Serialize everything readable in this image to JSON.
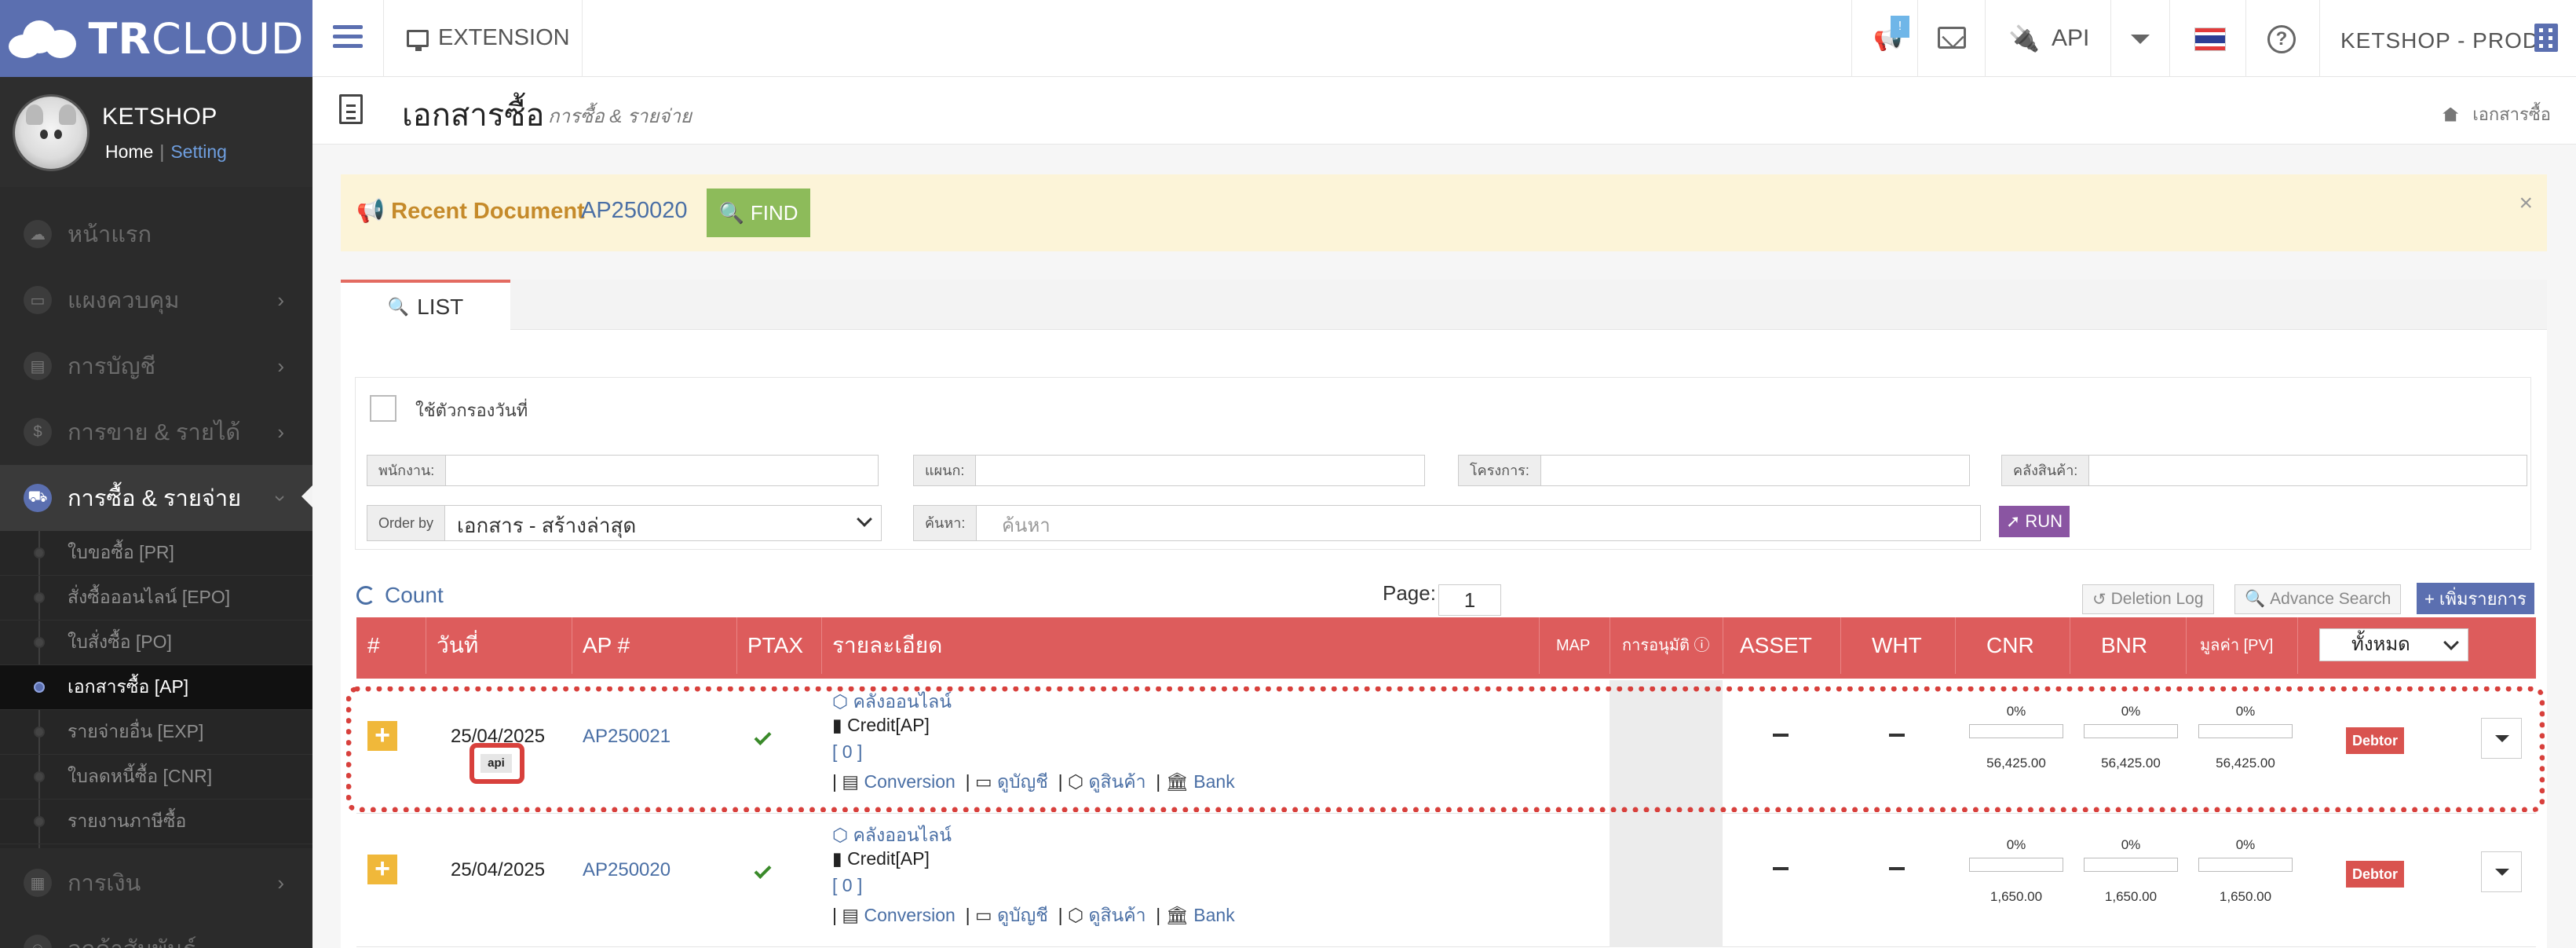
{
  "logo": {
    "bold": "TR",
    "light": "CLOUD"
  },
  "profile": {
    "name": "KETSHOP",
    "home": "Home",
    "sep": "|",
    "setting": "Setting"
  },
  "sidebar": {
    "items": [
      {
        "label": "หน้าแรก",
        "icon": "cloud-icon"
      },
      {
        "label": "แผงควบคุม",
        "icon": "monitor-icon"
      },
      {
        "label": "การบัญชี",
        "icon": "book-icon"
      },
      {
        "label": "การขาย & รายได้",
        "icon": "dollar-icon"
      },
      {
        "label": "การซื้อ & รายจ่าย",
        "icon": "cart-icon"
      },
      {
        "label": "การเงิน",
        "icon": "calendar-icon"
      },
      {
        "label": "ลูกค้าสัมพันธ์",
        "icon": "users-icon"
      }
    ],
    "sub_items": [
      "ใบขอซื้อ [PR]",
      "สั่งซื้อออนไลน์ [EPO]",
      "ใบสั่งซื้อ [PO]",
      "เอกสารซื้อ [AP]",
      "รายจ่ายอื่น [EXP]",
      "ใบลดหนี้ซื้อ [CNR]",
      "รายงานภาษีซื้อ"
    ]
  },
  "header": {
    "extension": "EXTENSION",
    "badge": "!",
    "api": "API",
    "account": "KETSHOP - PROD"
  },
  "page": {
    "title": "เอกสารซื้อ",
    "subtitle": "การซื้อ & รายจ่าย",
    "breadcrumb": "เอกสารซื้อ"
  },
  "recent": {
    "label": "Recent Document",
    "doc": "AP250020",
    "find": "FIND",
    "close": "×"
  },
  "tabs": {
    "list": "LIST"
  },
  "filter": {
    "date_filter": "ใช้ตัวกรองวันที่",
    "employee": "พนักงาน:",
    "department": "แผนก:",
    "project": "โครงการ:",
    "warehouse": "คลังสินค้า:",
    "order_by": "Order by",
    "order_value": "เอกสาร - สร้างล่าสุด",
    "search_label": "ค้นหา:",
    "search_placeholder": "ค้นหา",
    "run": "RUN"
  },
  "list": {
    "count": "Count",
    "page_label": "Page:",
    "page": "1",
    "deletion_log": "Deletion Log",
    "advanced_search": "Advance Search",
    "add": "+ เพิ่มรายการ"
  },
  "table": {
    "headers": {
      "no": "#",
      "date": "วันที่",
      "ap": "AP #",
      "ptax": "PTAX",
      "detail": "รายละเอียด",
      "map": "MAP",
      "approve": "การอนุมัติ",
      "asset": "ASSET",
      "wht": "WHT",
      "cnr": "CNR",
      "bnr": "BNR",
      "pv": "มูลค่า [PV]",
      "filter": "ทั้งหมด"
    },
    "rows": [
      {
        "date": "25/04/2025",
        "tag": "api",
        "ap": "AP250021",
        "warehouse": "คลังออนไลน์",
        "credit": "Credit[AP]",
        "bracket": "[ 0 ]",
        "links": [
          "Conversion",
          "ดูบัญชี",
          "ดูสินค้า",
          "Bank"
        ],
        "asset": "–",
        "wht": "–",
        "pcts": [
          "0%",
          "0%",
          "0%"
        ],
        "progress": [
          0,
          0,
          0
        ],
        "amounts": [
          "56,425.00",
          "56,425.00",
          "56,425.00"
        ],
        "status": "Debtor"
      },
      {
        "date": "25/04/2025",
        "tag": "",
        "ap": "AP250020",
        "warehouse": "คลังออนไลน์",
        "credit": "Credit[AP]",
        "bracket": "[ 0 ]",
        "links": [
          "Conversion",
          "ดูบัญชี",
          "ดูสินค้า",
          "Bank"
        ],
        "asset": "–",
        "wht": "–",
        "pcts": [
          "0%",
          "0%",
          "0%"
        ],
        "progress": [
          0,
          0,
          0
        ],
        "amounts": [
          "1,650.00",
          "1,650.00",
          "1,650.00"
        ],
        "status": "Debtor"
      }
    ]
  },
  "colors": {
    "brand": "#5b6fb0",
    "header_row": "#dd5c5c",
    "find": "#8dbb5a",
    "run": "#8a55a2",
    "debtor": "#d9534f",
    "highlight": "#d8403c"
  }
}
